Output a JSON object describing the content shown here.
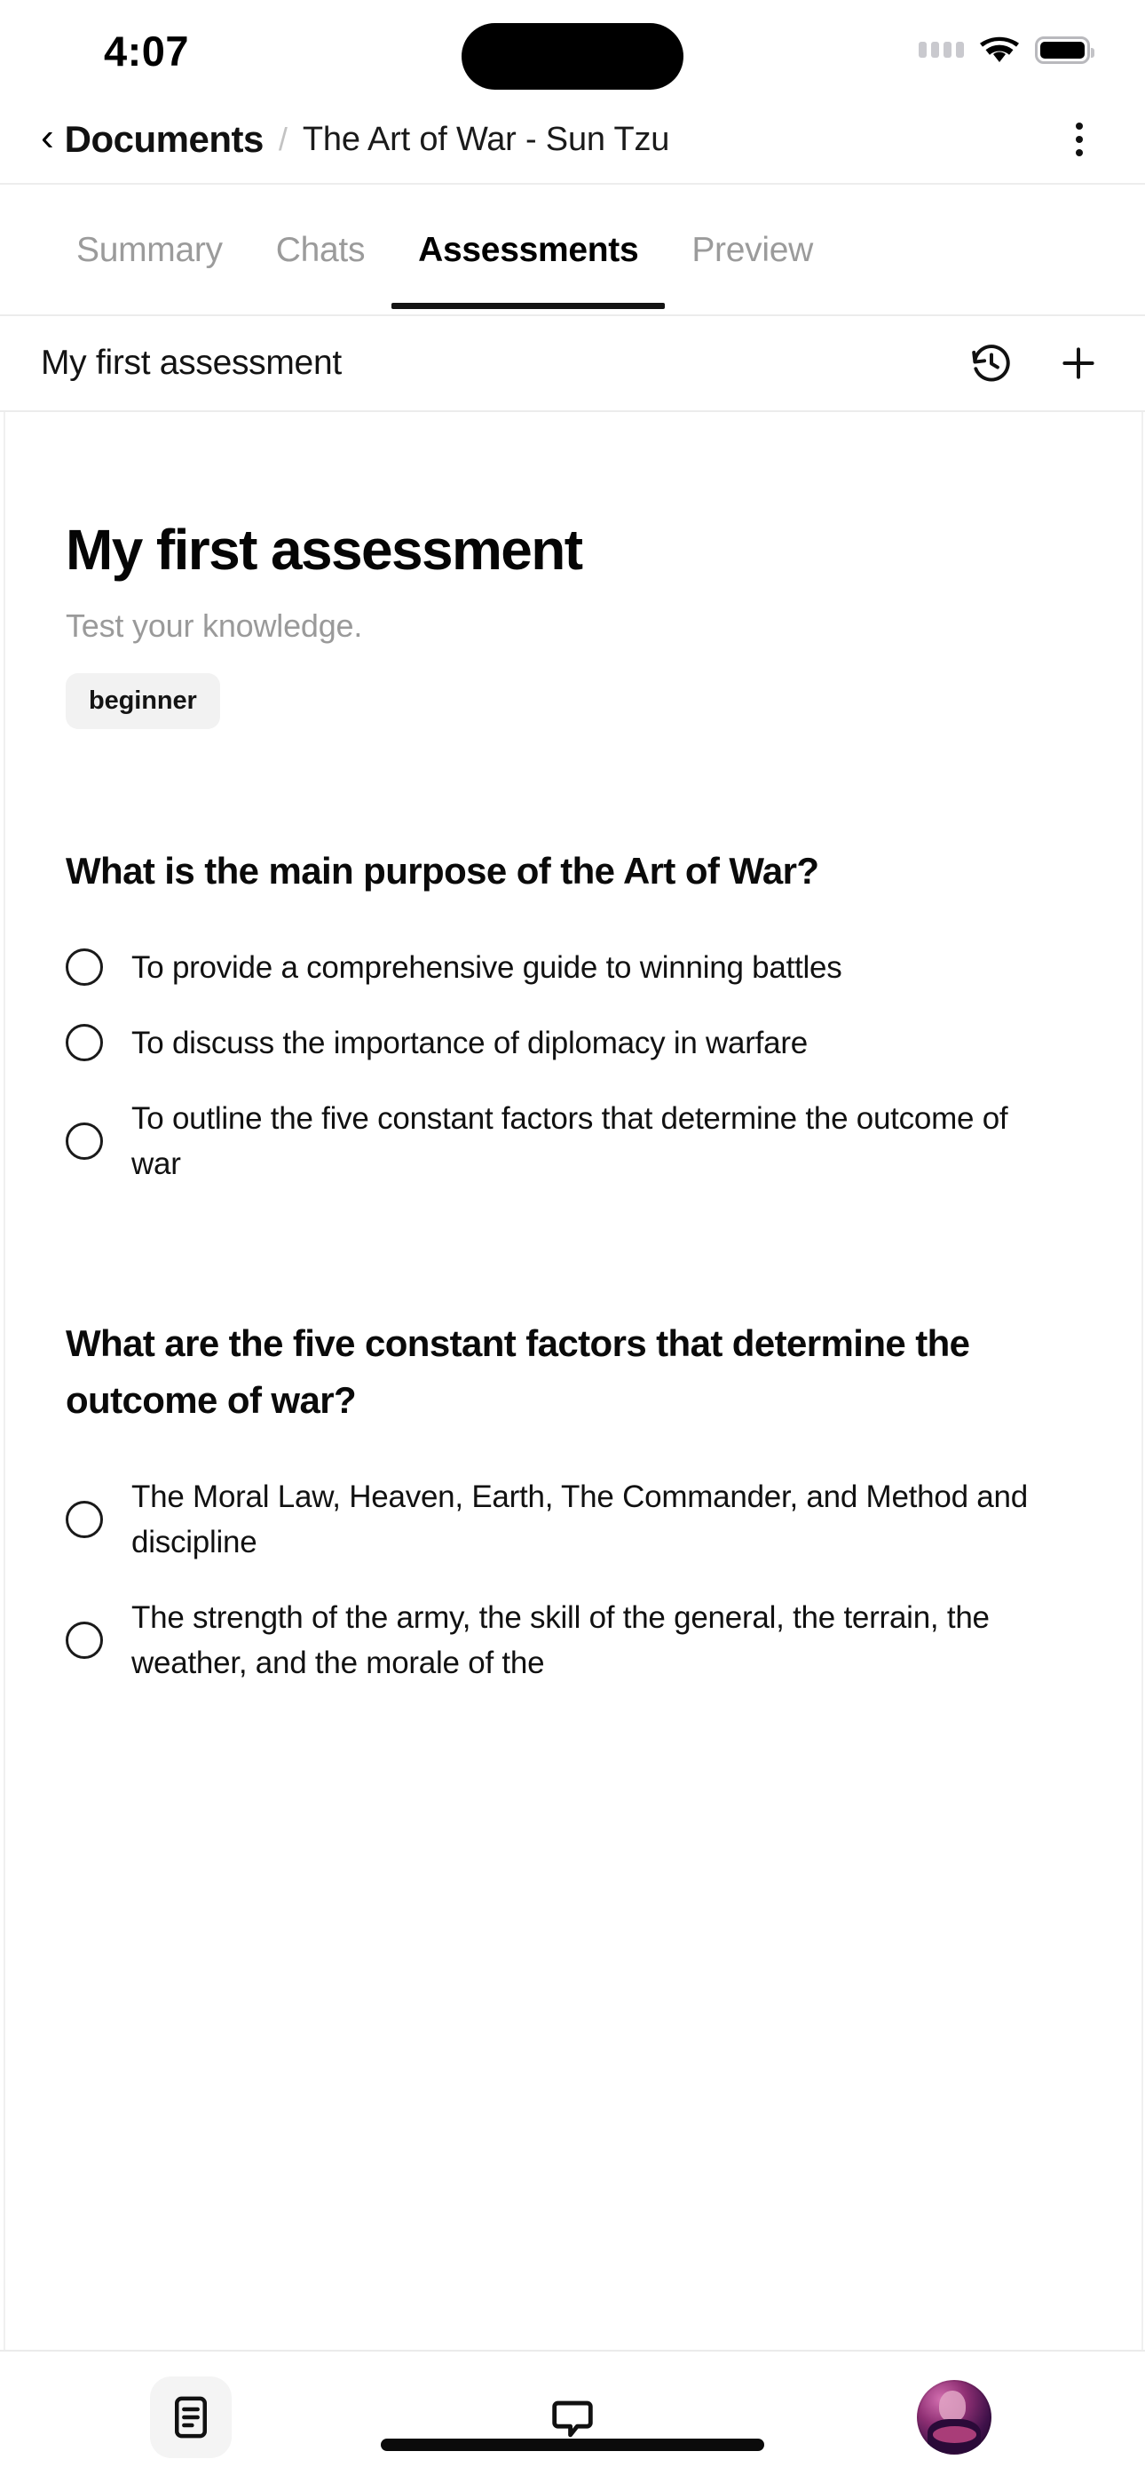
{
  "status_bar": {
    "time": "4:07",
    "signal_icon": "signal-dots-icon",
    "wifi_icon": "wifi-icon",
    "battery_icon": "battery-full-icon"
  },
  "header": {
    "back_icon": "chevron-left-icon",
    "root_crumb": "Documents",
    "separator": "/",
    "current_crumb": "The Art of War - Sun Tzu",
    "menu_icon": "kebab-menu-icon"
  },
  "tabs": [
    {
      "label": "Summary",
      "active": false
    },
    {
      "label": "Chats",
      "active": false
    },
    {
      "label": "Assessments",
      "active": true
    },
    {
      "label": "Preview",
      "active": false
    }
  ],
  "assessment_bar": {
    "title": "My first assessment",
    "history_icon": "history-clock-icon",
    "add_icon": "plus-icon"
  },
  "assessment": {
    "title": "My first assessment",
    "subtitle": "Test your knowledge.",
    "difficulty_badge": "beginner",
    "questions": [
      {
        "text": "What is the main purpose of the Art of War?",
        "options": [
          "To provide a comprehensive guide to winning battles",
          "To discuss the importance of diplomacy in warfare",
          "To outline the five constant factors that determine the outcome of war"
        ]
      },
      {
        "text": "What are the five constant factors that determine the outcome of war?",
        "options": [
          "The Moral Law, Heaven, Earth, The Commander, and Method and discipline",
          "The strength of the army, the skill of the general, the terrain, the weather, and the morale of the"
        ]
      }
    ]
  },
  "bottom_nav": [
    {
      "name": "documents",
      "icon": "document-lines-icon",
      "active": true
    },
    {
      "name": "chats",
      "icon": "chat-bubble-icon",
      "active": false
    },
    {
      "name": "profile",
      "icon": "avatar-image",
      "active": false
    }
  ],
  "colors": {
    "accent": "#141414",
    "muted_text": "#9b9b9b",
    "badge_bg": "#f2f2f2",
    "divider": "#ececec"
  }
}
